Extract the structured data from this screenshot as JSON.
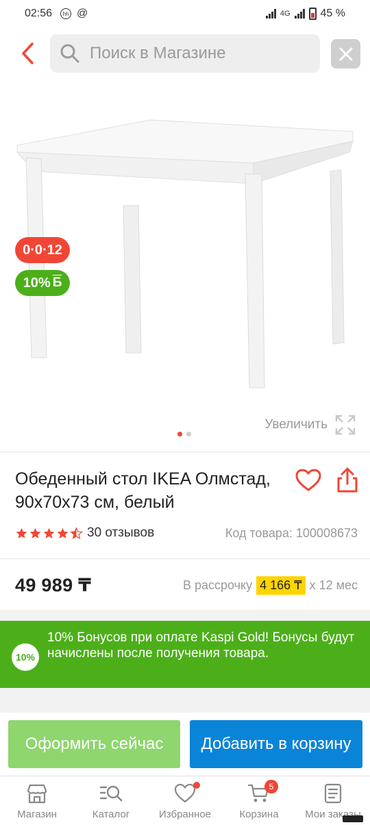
{
  "status_bar": {
    "time": "02:56",
    "notif_icon_label": "hh",
    "at_symbol": "@",
    "network": "4G",
    "battery": "45 %"
  },
  "search": {
    "placeholder": "Поиск в Магазине"
  },
  "badges": {
    "installment": "0·0·12",
    "bonus": "10%",
    "bonus_symbol": "Б"
  },
  "gallery": {
    "zoom_label": "Увеличить",
    "image_count": 2,
    "active_image": 1
  },
  "product": {
    "title": "Обеденный стол IKEA Олмстад, 90x70x73 см, белый",
    "rating": 4.5,
    "reviews": "30 отзывов",
    "sku": "Код товара: 100008673",
    "price": "49 989 ₸",
    "installment_prefix": "В рассрочку",
    "installment_amount": "4 166 ₸",
    "installment_suffix": "x 12 мес"
  },
  "bonus_banner": {
    "badge": "10%",
    "text": "10% Бонусов при оплате Kaspi Gold! Бонусы будут начислены после получения товара."
  },
  "actions": {
    "buy_now": "Оформить сейчас",
    "add_to_cart": "Добавить в корзину"
  },
  "tabs": [
    {
      "label": "Магазин",
      "icon": "store-icon"
    },
    {
      "label": "Каталог",
      "icon": "catalog-icon"
    },
    {
      "label": "Избранное",
      "icon": "heart-icon"
    },
    {
      "label": "Корзина",
      "icon": "cart-icon",
      "badge": "5"
    },
    {
      "label": "Мои заказы",
      "icon": "orders-icon"
    }
  ],
  "colors": {
    "accent_red": "#f14635",
    "bonus_green": "#4caf1a",
    "buy_now_green": "#8ed66d",
    "cart_blue": "#0a84d6",
    "installment_yellow": "#ffd400"
  }
}
